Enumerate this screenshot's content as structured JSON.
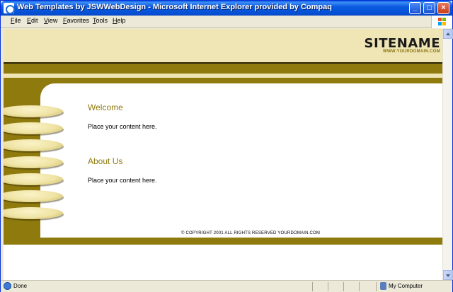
{
  "window": {
    "title": "Web Templates by JSWWebDesign - Microsoft Internet Explorer provided by Compaq"
  },
  "menu": {
    "items": [
      "File",
      "Edit",
      "View",
      "Favorites",
      "Tools",
      "Help"
    ]
  },
  "site": {
    "name": "SITENAME",
    "domain": "WWW.YOURDOMAIN.COM",
    "sections": [
      {
        "heading": "Welcome",
        "text": "Place your content here."
      },
      {
        "heading": "About Us",
        "text": "Place your content here."
      }
    ],
    "copyright": "© COPYRIGHT 2001 ALL RIGHTS RESERVED YOURDOMAIN.COM",
    "nav_discs": 7
  },
  "status": {
    "text": "Done",
    "zone": "My Computer"
  },
  "colors": {
    "accent": "#8f7a0e",
    "header_bg": "#efe5b5",
    "titlebar": "#0b5be0"
  },
  "icons": [
    "ie-logo-icon",
    "minimize-icon",
    "maximize-icon",
    "close-icon",
    "windows-flag-icon",
    "scroll-up-icon",
    "scroll-down-icon",
    "ie-page-icon",
    "computer-icon"
  ]
}
